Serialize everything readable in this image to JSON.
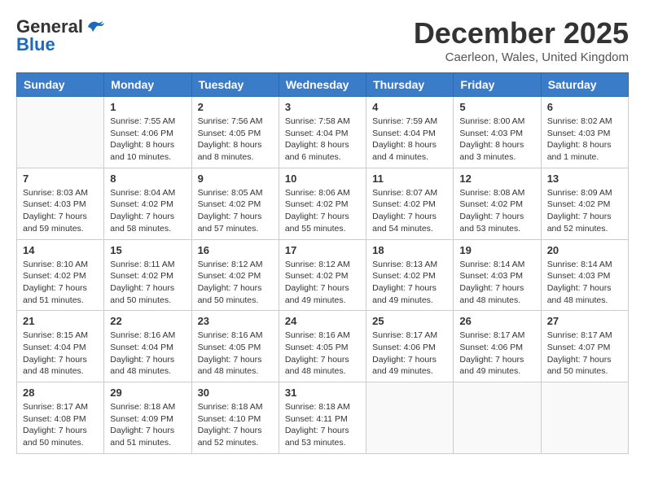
{
  "header": {
    "logo_general": "General",
    "logo_blue": "Blue",
    "month": "December 2025",
    "location": "Caerleon, Wales, United Kingdom"
  },
  "weekdays": [
    "Sunday",
    "Monday",
    "Tuesday",
    "Wednesday",
    "Thursday",
    "Friday",
    "Saturday"
  ],
  "weeks": [
    [
      {
        "day": "",
        "info": ""
      },
      {
        "day": "1",
        "info": "Sunrise: 7:55 AM\nSunset: 4:06 PM\nDaylight: 8 hours\nand 10 minutes."
      },
      {
        "day": "2",
        "info": "Sunrise: 7:56 AM\nSunset: 4:05 PM\nDaylight: 8 hours\nand 8 minutes."
      },
      {
        "day": "3",
        "info": "Sunrise: 7:58 AM\nSunset: 4:04 PM\nDaylight: 8 hours\nand 6 minutes."
      },
      {
        "day": "4",
        "info": "Sunrise: 7:59 AM\nSunset: 4:04 PM\nDaylight: 8 hours\nand 4 minutes."
      },
      {
        "day": "5",
        "info": "Sunrise: 8:00 AM\nSunset: 4:03 PM\nDaylight: 8 hours\nand 3 minutes."
      },
      {
        "day": "6",
        "info": "Sunrise: 8:02 AM\nSunset: 4:03 PM\nDaylight: 8 hours\nand 1 minute."
      }
    ],
    [
      {
        "day": "7",
        "info": "Sunrise: 8:03 AM\nSunset: 4:03 PM\nDaylight: 7 hours\nand 59 minutes."
      },
      {
        "day": "8",
        "info": "Sunrise: 8:04 AM\nSunset: 4:02 PM\nDaylight: 7 hours\nand 58 minutes."
      },
      {
        "day": "9",
        "info": "Sunrise: 8:05 AM\nSunset: 4:02 PM\nDaylight: 7 hours\nand 57 minutes."
      },
      {
        "day": "10",
        "info": "Sunrise: 8:06 AM\nSunset: 4:02 PM\nDaylight: 7 hours\nand 55 minutes."
      },
      {
        "day": "11",
        "info": "Sunrise: 8:07 AM\nSunset: 4:02 PM\nDaylight: 7 hours\nand 54 minutes."
      },
      {
        "day": "12",
        "info": "Sunrise: 8:08 AM\nSunset: 4:02 PM\nDaylight: 7 hours\nand 53 minutes."
      },
      {
        "day": "13",
        "info": "Sunrise: 8:09 AM\nSunset: 4:02 PM\nDaylight: 7 hours\nand 52 minutes."
      }
    ],
    [
      {
        "day": "14",
        "info": "Sunrise: 8:10 AM\nSunset: 4:02 PM\nDaylight: 7 hours\nand 51 minutes."
      },
      {
        "day": "15",
        "info": "Sunrise: 8:11 AM\nSunset: 4:02 PM\nDaylight: 7 hours\nand 50 minutes."
      },
      {
        "day": "16",
        "info": "Sunrise: 8:12 AM\nSunset: 4:02 PM\nDaylight: 7 hours\nand 50 minutes."
      },
      {
        "day": "17",
        "info": "Sunrise: 8:12 AM\nSunset: 4:02 PM\nDaylight: 7 hours\nand 49 minutes."
      },
      {
        "day": "18",
        "info": "Sunrise: 8:13 AM\nSunset: 4:02 PM\nDaylight: 7 hours\nand 49 minutes."
      },
      {
        "day": "19",
        "info": "Sunrise: 8:14 AM\nSunset: 4:03 PM\nDaylight: 7 hours\nand 48 minutes."
      },
      {
        "day": "20",
        "info": "Sunrise: 8:14 AM\nSunset: 4:03 PM\nDaylight: 7 hours\nand 48 minutes."
      }
    ],
    [
      {
        "day": "21",
        "info": "Sunrise: 8:15 AM\nSunset: 4:04 PM\nDaylight: 7 hours\nand 48 minutes."
      },
      {
        "day": "22",
        "info": "Sunrise: 8:16 AM\nSunset: 4:04 PM\nDaylight: 7 hours\nand 48 minutes."
      },
      {
        "day": "23",
        "info": "Sunrise: 8:16 AM\nSunset: 4:05 PM\nDaylight: 7 hours\nand 48 minutes."
      },
      {
        "day": "24",
        "info": "Sunrise: 8:16 AM\nSunset: 4:05 PM\nDaylight: 7 hours\nand 48 minutes."
      },
      {
        "day": "25",
        "info": "Sunrise: 8:17 AM\nSunset: 4:06 PM\nDaylight: 7 hours\nand 49 minutes."
      },
      {
        "day": "26",
        "info": "Sunrise: 8:17 AM\nSunset: 4:06 PM\nDaylight: 7 hours\nand 49 minutes."
      },
      {
        "day": "27",
        "info": "Sunrise: 8:17 AM\nSunset: 4:07 PM\nDaylight: 7 hours\nand 50 minutes."
      }
    ],
    [
      {
        "day": "28",
        "info": "Sunrise: 8:17 AM\nSunset: 4:08 PM\nDaylight: 7 hours\nand 50 minutes."
      },
      {
        "day": "29",
        "info": "Sunrise: 8:18 AM\nSunset: 4:09 PM\nDaylight: 7 hours\nand 51 minutes."
      },
      {
        "day": "30",
        "info": "Sunrise: 8:18 AM\nSunset: 4:10 PM\nDaylight: 7 hours\nand 52 minutes."
      },
      {
        "day": "31",
        "info": "Sunrise: 8:18 AM\nSunset: 4:11 PM\nDaylight: 7 hours\nand 53 minutes."
      },
      {
        "day": "",
        "info": ""
      },
      {
        "day": "",
        "info": ""
      },
      {
        "day": "",
        "info": ""
      }
    ]
  ]
}
